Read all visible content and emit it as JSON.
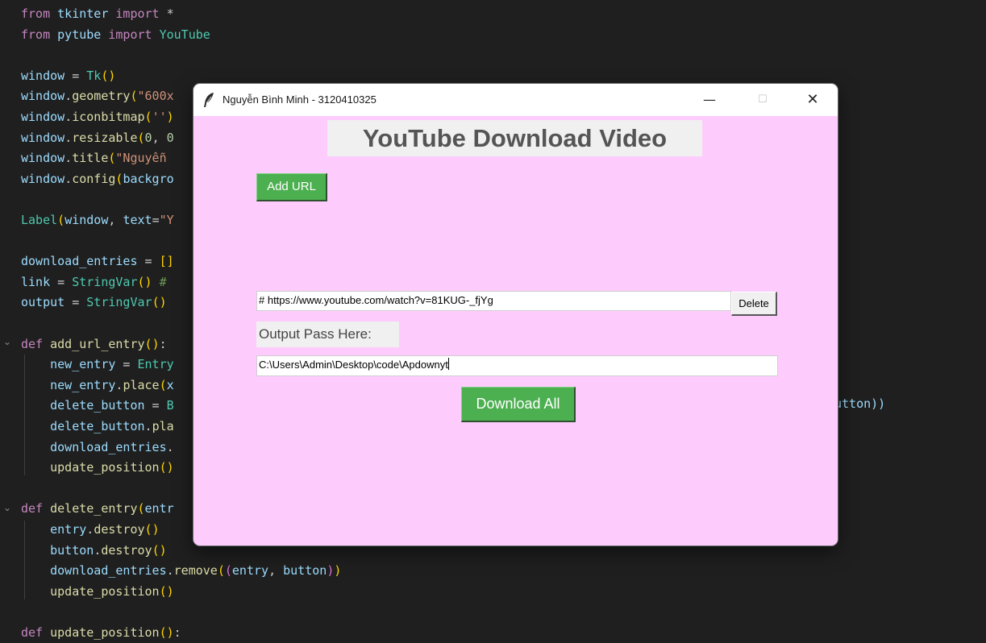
{
  "editor": {
    "lines": [
      "from tkinter import *",
      "from pytube import YouTube",
      "",
      "window = Tk()",
      "window.geometry(\"600x",
      "window.iconbitmap('')",
      "window.resizable(0, 0",
      "window.title(\"Nguyễn",
      "window.config(backgro",
      "",
      "Label(window, text=\"Y",
      "",
      "download_entries = []",
      "link = StringVar() #",
      "output = StringVar()",
      "",
      "def add_url_entry():",
      "    new_entry = Entry",
      "    new_entry.place(x",
      "    delete_button = B",
      "    delete_button.pla",
      "    download_entries.",
      "    update_position()",
      "",
      "def delete_entry(entr",
      "    entry.destroy()",
      "    button.destroy()",
      "    download_entries.remove((entry, button))",
      "    update_position()",
      "",
      "def update_position():"
    ],
    "overflow_text": "utton))"
  },
  "window": {
    "title": "Nguyễn Bình Minh - 3120410325",
    "minimize": "—",
    "maximize": "☐",
    "close": "✕"
  },
  "app": {
    "heading": "YouTube Download Video",
    "add_url_label": "Add URL",
    "url_entry_value": "# https://www.youtube.com/watch?v=81KUG-_fjYg",
    "delete_label": "Delete",
    "output_label": "Output Pass Here:",
    "output_entry_value": "C:\\Users\\Admin\\Desktop\\code\\Apdownyt",
    "download_all_label": "Download All"
  },
  "colors": {
    "window_background": "#fdccfd",
    "button_green": "#4caf50",
    "editor_background": "#1f1f1f"
  }
}
